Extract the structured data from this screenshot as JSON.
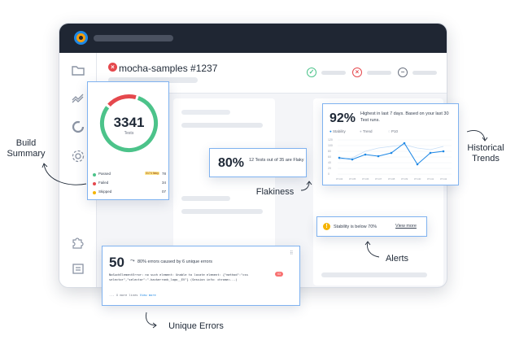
{
  "run": {
    "title": "mocha-samples #1237"
  },
  "build_summary": {
    "total": "3341",
    "total_label": "Tests",
    "legend": [
      {
        "label": "Passed",
        "count": "78",
        "color": "#4cc38a",
        "badge": "3174 flaky"
      },
      {
        "label": "Failed",
        "count": "34",
        "color": "#e5484d",
        "badge": ""
      },
      {
        "label": "Skipped",
        "count": "07",
        "color": "#f5b400",
        "badge": ""
      }
    ]
  },
  "flakiness": {
    "percent": "80%",
    "text": "12 Tests out of 35 are Flaky"
  },
  "trends": {
    "percent": "92%",
    "text": "Highest in last 7 days. Based on your last 30 Test runs.",
    "legend": [
      "Stability",
      "Trend",
      "P10"
    ],
    "y_ticks": [
      "120",
      "100",
      "80",
      "60",
      "40",
      "20",
      "0"
    ],
    "x_ticks": [
      "#7134",
      "#7135",
      "#7136",
      "#7137",
      "#7138",
      "#7139",
      "#7140",
      "#7141",
      "#7142"
    ]
  },
  "alert": {
    "text": "Stability is below 70%",
    "link": "View more"
  },
  "unique_errors": {
    "count": "50",
    "text": "80% errors caused by 6 unique errors",
    "message": "NoSuchElementError: no such element: Unable to locate element: {\"method\":\"css selector\",\"selector\":\".hackerrank_logo__EV\"} (Session info: chrome=...)",
    "more_prefix": "... X more lines",
    "more_link": "View more",
    "badge": "03"
  },
  "annotations": {
    "build_summary": "Build\nSummary",
    "historical_trends": "Historical\nTrends",
    "flakiness": "Flakiness",
    "alerts": "Alerts",
    "unique_errors": "Unique Errors"
  },
  "colors": {
    "accent": "#1e88e5",
    "passed": "#4cc38a",
    "failed": "#e5484d",
    "warning": "#f5b400",
    "topbar": "#1f2633"
  },
  "icons": [
    "folder-icon",
    "trend-icon",
    "ring-icon",
    "gear-icon",
    "puzzle-icon",
    "list-icon",
    "check-circle-icon",
    "x-circle-icon",
    "minus-circle-icon"
  ]
}
